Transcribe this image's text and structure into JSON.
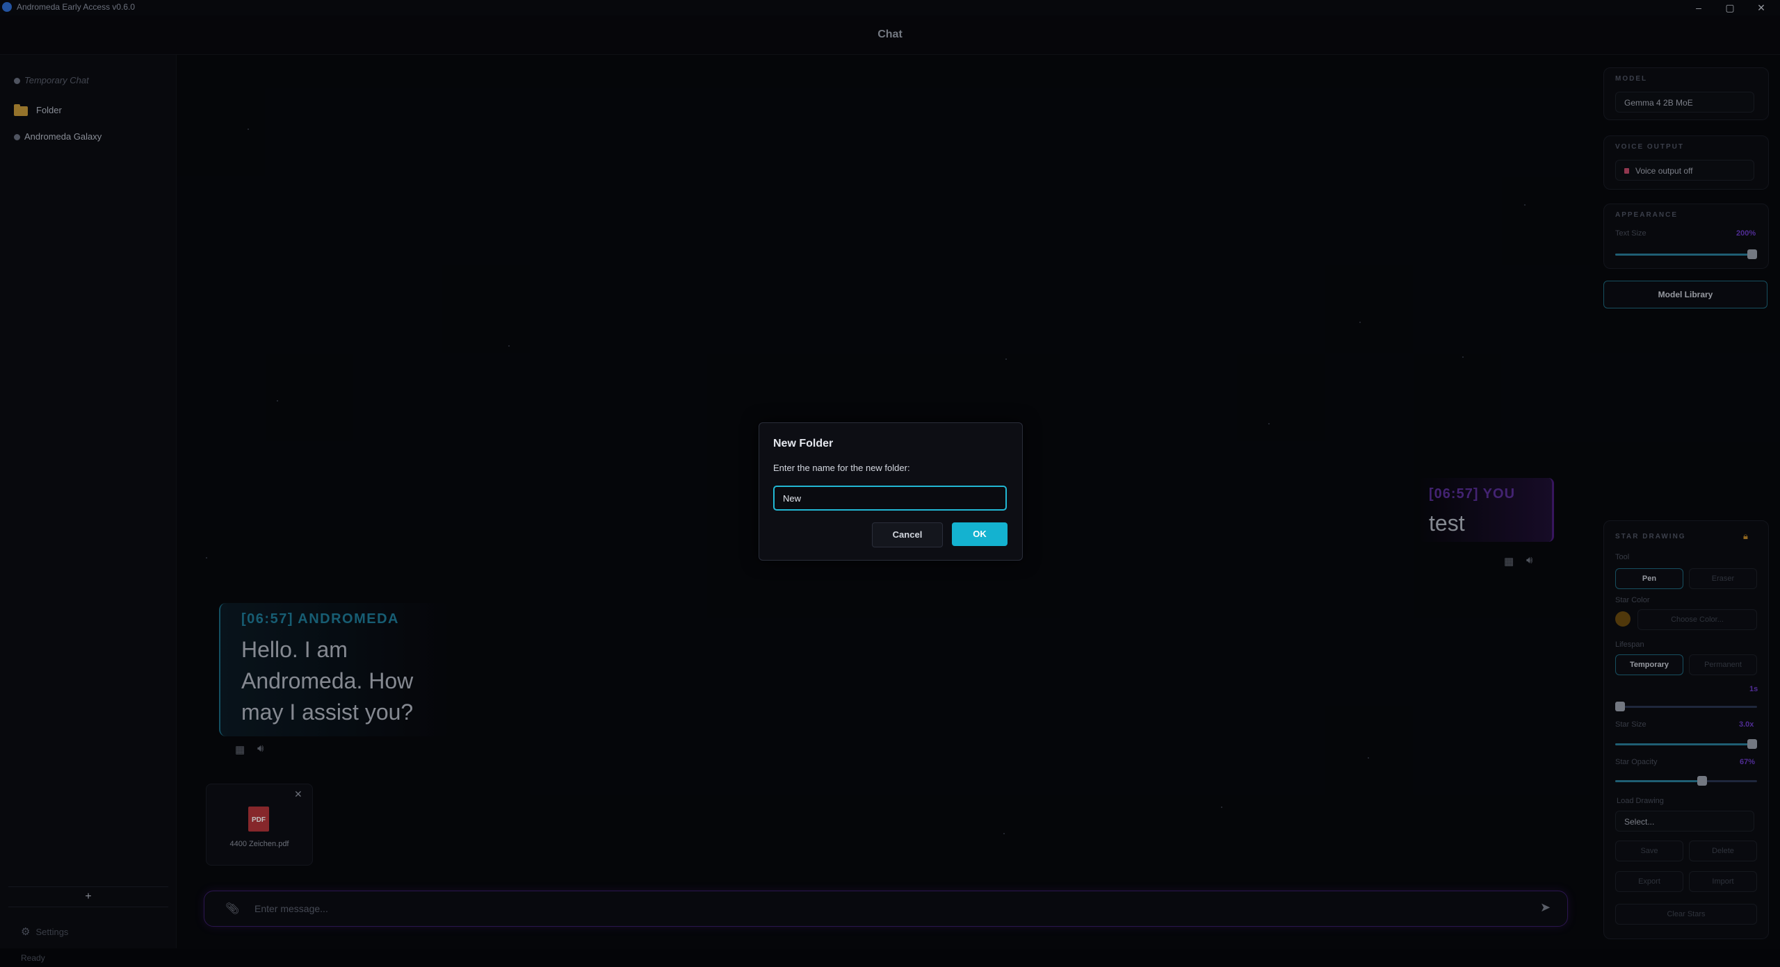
{
  "window": {
    "app_title": "Andromeda Early Access v0.6.0",
    "minimize": "–",
    "maximize": "▢",
    "close": "✕"
  },
  "header": {
    "title": "Chat"
  },
  "sidebar": {
    "items": [
      {
        "label": "Temporary Chat"
      },
      {
        "label": "Folder"
      },
      {
        "label": "Andromeda Galaxy"
      }
    ],
    "add_label": "+",
    "settings_label": "Settings"
  },
  "messages": {
    "bot": {
      "header": "[06:57] ANDROMEDA",
      "text": "Hello. I am Andromeda. How may I assist you?"
    },
    "user": {
      "header": "[06:57] YOU",
      "text": "test"
    }
  },
  "attachment": {
    "filename": "4400 Zeichen.pdf",
    "type_label": "PDF",
    "remove": "✕"
  },
  "composer": {
    "placeholder": "Enter message..."
  },
  "right_panel": {
    "model": {
      "label": "MODEL",
      "value": "Gemma 4 2B MoE"
    },
    "voice": {
      "label": "VOICE OUTPUT",
      "value": "Voice output off"
    },
    "appearance": {
      "label": "APPEARANCE",
      "text_size_label": "Text Size",
      "text_size_value": "200%",
      "text_size_level": 1.0
    },
    "library_button": "Model Library",
    "star_drawing": {
      "label": "STAR DRAWING",
      "tool_label": "Tool",
      "pen": "Pen",
      "eraser": "Eraser",
      "color_label": "Star Color",
      "choose_color": "Choose Color...",
      "lifespan_label": "Lifespan",
      "temporary": "Temporary",
      "permanent": "Permanent",
      "lifespan_value": "1s",
      "lifespan_level": 0.0,
      "size_label": "Star Size",
      "size_value": "3.0x",
      "size_level": 1.0,
      "opacity_label": "Star Opacity",
      "opacity_value": "67%",
      "opacity_level": 0.62,
      "load_label": "Load Drawing",
      "load_select": "Select...",
      "save": "Save",
      "delete": "Delete",
      "export": "Export",
      "import": "Import",
      "clear": "Clear Stars",
      "color_swatch": "#6b4b0f"
    }
  },
  "dialog": {
    "title": "New Folder",
    "prompt": "Enter the name for the new folder:",
    "input_value": "New",
    "cancel": "Cancel",
    "ok": "OK"
  },
  "status": {
    "text": "Ready"
  },
  "colors": {
    "accent": "#14b2d0",
    "user_accent": "#5a2f99",
    "bot_accent": "#1f7d9a"
  }
}
